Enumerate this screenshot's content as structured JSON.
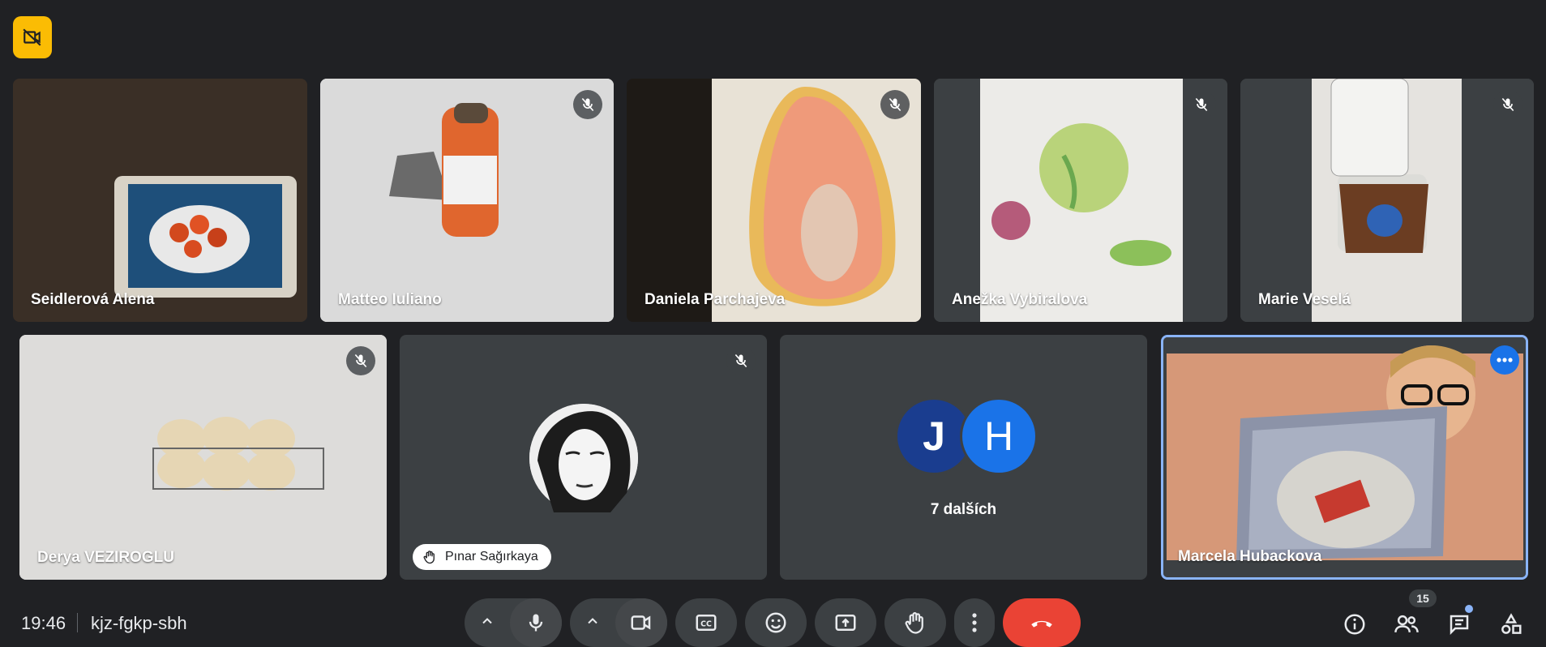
{
  "meeting": {
    "time": "19:46",
    "code": "kjz-fgkp-sbh"
  },
  "participants_row1": [
    {
      "name": "Seidlerová Alena"
    },
    {
      "name": "Matteo Iuliano"
    },
    {
      "name": "Daniela Parchajeva"
    },
    {
      "name": "Anežka Vybiralova"
    },
    {
      "name": "Marie Veselá"
    }
  ],
  "participants_row2": [
    {
      "name": "Derya VEZIROGLU"
    },
    {
      "name": "Pınar Sağırkaya"
    },
    {
      "name": "7 dalších",
      "avatars": [
        "J",
        "H"
      ]
    },
    {
      "name": "Marcela Hubackova"
    }
  ],
  "people_count": "15",
  "colors": {
    "background": "#202124",
    "tile": "#3c4043",
    "end_call": "#ea4335",
    "badge": "#fbbc04",
    "active_border": "#8ab4f8",
    "avatar_j": "#1a3d8f",
    "avatar_h": "#1a73e8"
  }
}
